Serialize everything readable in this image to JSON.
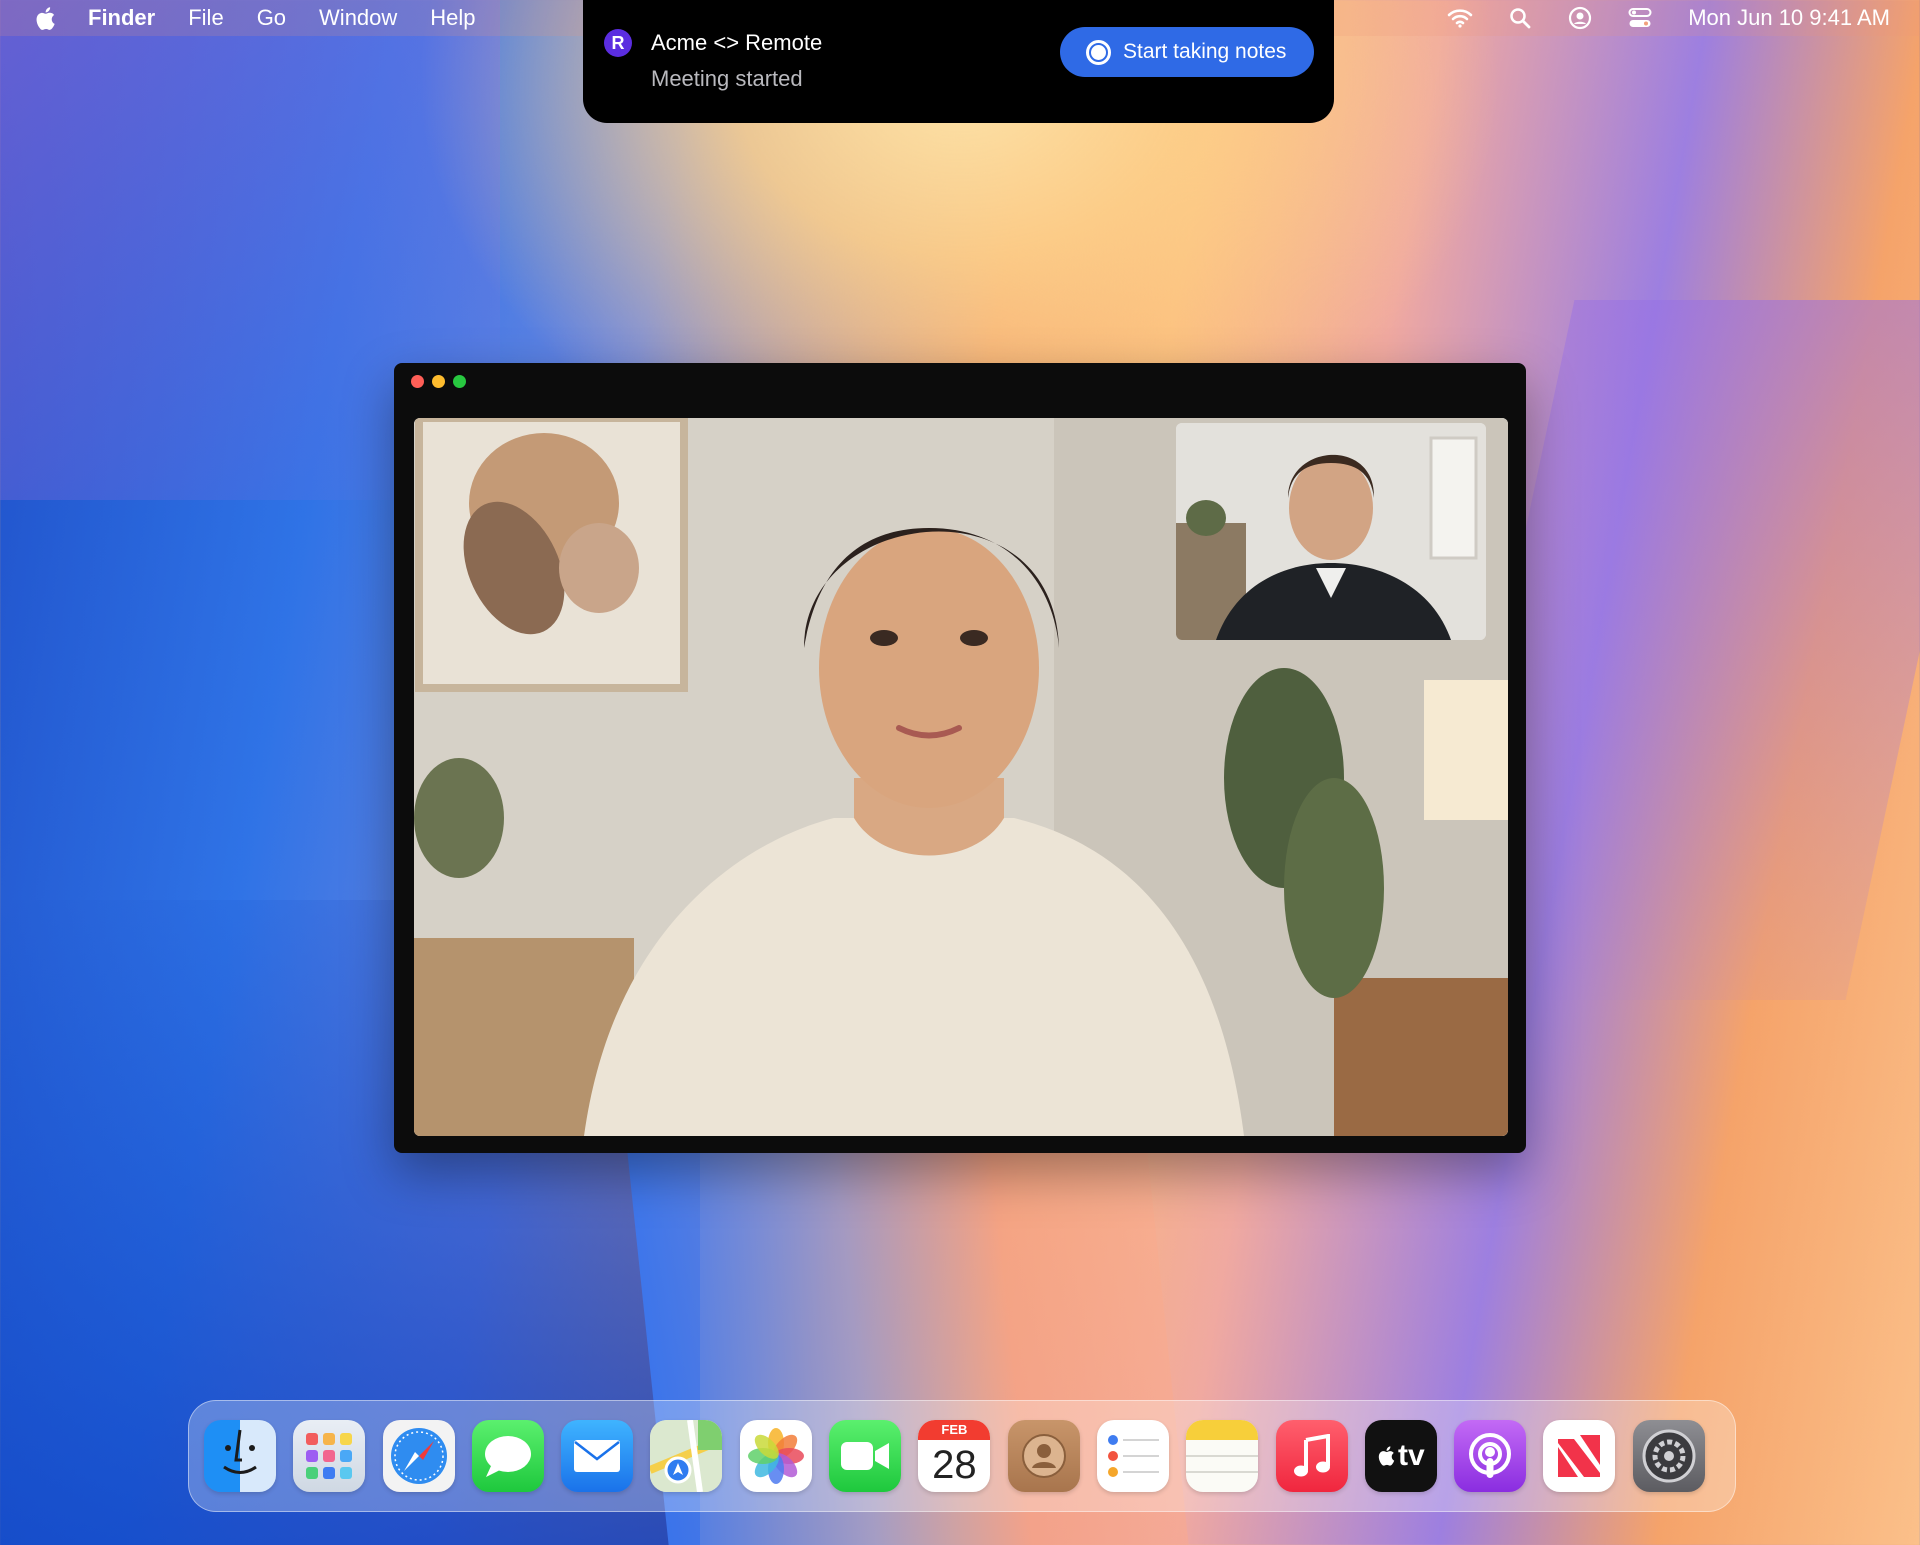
{
  "menubar": {
    "app_name": "Finder",
    "menus": [
      "File",
      "Go",
      "Window",
      "Help"
    ],
    "status_icons": [
      "wifi-icon",
      "search-icon",
      "user-icon",
      "control-center-icon"
    ],
    "clock": "Mon Jun 10  9:41 AM"
  },
  "notification": {
    "logo_letter": "R",
    "title": "Acme <> Remote",
    "subtitle": "Meeting started",
    "button_label": "Start taking notes",
    "accent": "#2f6ae6",
    "logo_color": "#5b2de0"
  },
  "dock": {
    "items": [
      "finder",
      "launchpad",
      "safari",
      "messages",
      "mail",
      "maps",
      "photos",
      "facetime",
      "calendar",
      "contacts",
      "reminders",
      "notes",
      "music",
      "apple-tv",
      "podcasts",
      "news",
      "system-settings"
    ],
    "calendar": {
      "month": "FEB",
      "day": "28"
    },
    "tv_label": "tv"
  }
}
